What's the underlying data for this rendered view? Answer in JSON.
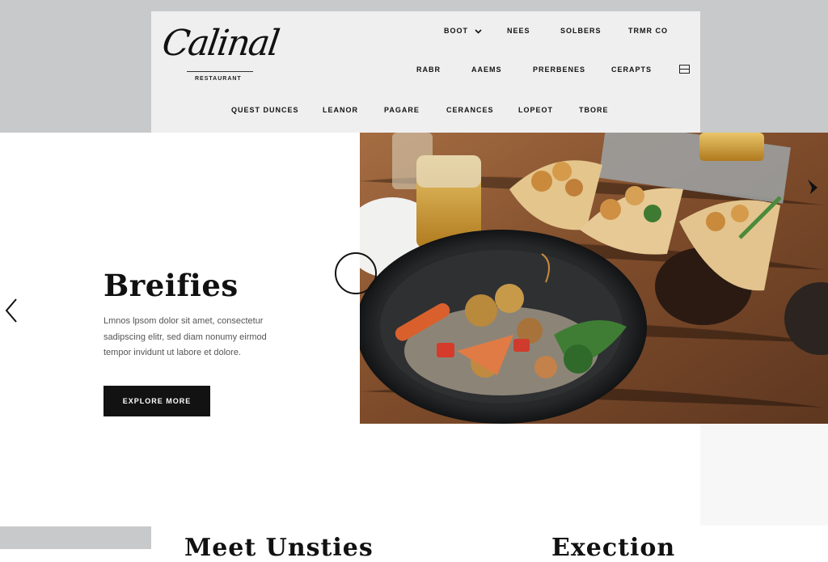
{
  "brand": {
    "logo_script": "Calinal",
    "logo_subtitle": "RESTAURANT"
  },
  "nav": {
    "top_row": [
      "BOOT",
      "NEES",
      "SOLBERS",
      "TRMR CO"
    ],
    "middle_row": [
      "RABR",
      "AAEMS",
      "PRERBENES",
      "CERAPTS"
    ],
    "bottom_row": [
      "QUEST DUNCES",
      "LEANOR",
      "PAGARE",
      "CERANCES",
      "LOPEOT",
      "TBORE"
    ],
    "menu_icon": "menu-icon",
    "dropdown_icon": "chevron-down-icon"
  },
  "hero": {
    "title": "Breifies",
    "body": "Lmnos lpsom dolor sit amet, consectetur sadipscing elitr, sed diam nonumy eirmod tempor invidunt ut labore et dolore.",
    "cta_label": "EXPLORE MORE",
    "prev_icon": "chevron-left-icon",
    "next_icon": "arrow-right-icon",
    "slider_icon": "circle-icon"
  },
  "sections": {
    "left_title": "Meet Unsties",
    "right_title": "Exection"
  },
  "colors": {
    "band": "#c8c9ca",
    "header_bg": "#efefef",
    "cta_bg": "#121212",
    "wood": "#8a5a36"
  }
}
